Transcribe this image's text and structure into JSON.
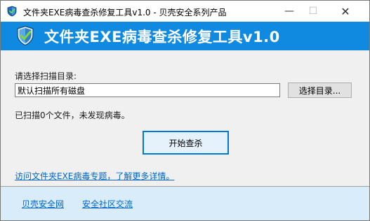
{
  "titlebar": {
    "title": "文件夹EXE病毒查杀修复工具v1.0 - 贝壳安全系列产品",
    "minimize": "—",
    "maximize": "☐",
    "close": "✕",
    "icon": "shield-icon"
  },
  "banner": {
    "title": "文件夹EXE病毒查杀修复工具v1.0",
    "icon": "shield-icon",
    "background_color": "#0f8ae0"
  },
  "scan_dir": {
    "label": "请选择扫描目录:",
    "value": "默认扫描所有磁盘",
    "browse_label": "选择目录..."
  },
  "status": {
    "text": "已扫描0个文件，未发现病毒。"
  },
  "actions": {
    "scan_label": "开始查杀"
  },
  "links": {
    "topic": "访问文件夹EXE病毒专题，了解更多详情。"
  },
  "footer": {
    "background_color": "#d8ecfa",
    "links": [
      "贝壳安全网",
      "安全社区交流"
    ]
  }
}
